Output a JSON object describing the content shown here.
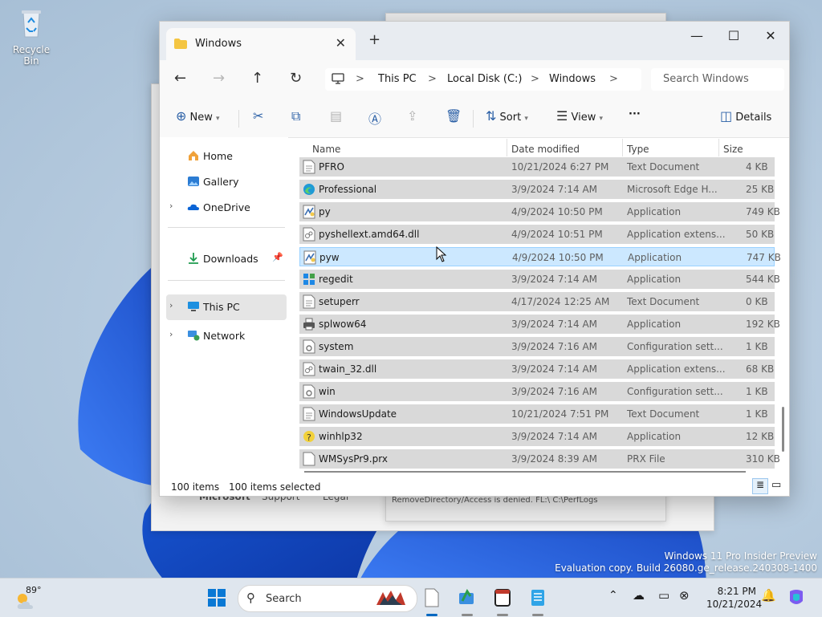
{
  "desktop": {
    "recycle_bin_label": "Recycle Bin",
    "watermark_line1": "Windows 11 Pro Insider Preview",
    "watermark_line2": "Evaluation copy. Build 26080.ge_release.240308-1400",
    "bg_window_texts": [
      "Microsoft",
      "Support",
      "Legal",
      "RemoveDirectory/Access is denied. FL:\\ C:\\PerfLogs"
    ]
  },
  "window": {
    "tab_title": "Windows",
    "controls": {
      "minimize": "—",
      "maximize": "☐",
      "close": "✕"
    },
    "address": {
      "crumbs": [
        "This PC",
        "Local Disk (C:)",
        "Windows"
      ],
      "separator": ">",
      "search_placeholder": "Search Windows"
    },
    "commands": {
      "new_label": "New",
      "sort_label": "Sort",
      "view_label": "View",
      "more_label": "···",
      "details_label": "Details"
    },
    "nav": {
      "home": "Home",
      "gallery": "Gallery",
      "onedrive": "OneDrive",
      "downloads": "Downloads",
      "thispc": "This PC",
      "network": "Network"
    },
    "columns": {
      "name": "Name",
      "date": "Date modified",
      "type": "Type",
      "size": "Size"
    },
    "rows": [
      {
        "name": "PFRO",
        "date": "10/21/2024 6:27 PM",
        "type": "Text Document",
        "size": "4 KB",
        "icon": "text-file"
      },
      {
        "name": "Professional",
        "date": "3/9/2024 7:14 AM",
        "type": "Microsoft Edge H...",
        "size": "25 KB",
        "icon": "edge"
      },
      {
        "name": "py",
        "date": "4/9/2024 10:50 PM",
        "type": "Application",
        "size": "749 KB",
        "icon": "python"
      },
      {
        "name": "pyshellext.amd64.dll",
        "date": "4/9/2024 10:51 PM",
        "type": "Application extens...",
        "size": "50 KB",
        "icon": "dll"
      },
      {
        "name": "pyw",
        "date": "4/9/2024 10:50 PM",
        "type": "Application",
        "size": "747 KB",
        "icon": "python"
      },
      {
        "name": "regedit",
        "date": "3/9/2024 7:14 AM",
        "type": "Application",
        "size": "544 KB",
        "icon": "regedit"
      },
      {
        "name": "setuperr",
        "date": "4/17/2024 12:25 AM",
        "type": "Text Document",
        "size": "0 KB",
        "icon": "text-file"
      },
      {
        "name": "splwow64",
        "date": "3/9/2024 7:14 AM",
        "type": "Application",
        "size": "192 KB",
        "icon": "printer"
      },
      {
        "name": "system",
        "date": "3/9/2024 7:16 AM",
        "type": "Configuration sett...",
        "size": "1 KB",
        "icon": "config"
      },
      {
        "name": "twain_32.dll",
        "date": "3/9/2024 7:14 AM",
        "type": "Application extens...",
        "size": "68 KB",
        "icon": "dll"
      },
      {
        "name": "win",
        "date": "3/9/2024 7:16 AM",
        "type": "Configuration sett...",
        "size": "1 KB",
        "icon": "config"
      },
      {
        "name": "WindowsUpdate",
        "date": "10/21/2024 7:51 PM",
        "type": "Text Document",
        "size": "1 KB",
        "icon": "text-file"
      },
      {
        "name": "winhlp32",
        "date": "3/9/2024 7:14 AM",
        "type": "Application",
        "size": "12 KB",
        "icon": "help"
      },
      {
        "name": "WMSysPr9.prx",
        "date": "3/9/2024 8:39 AM",
        "type": "PRX File",
        "size": "310 KB",
        "icon": "blank-file"
      }
    ],
    "status": {
      "count": "100 items",
      "selected": "100 items selected"
    }
  },
  "taskbar": {
    "weather_temp": "89°",
    "search_label": "Search",
    "time": "8:21 PM",
    "date": "10/21/2024",
    "accent": "#0067c0"
  }
}
